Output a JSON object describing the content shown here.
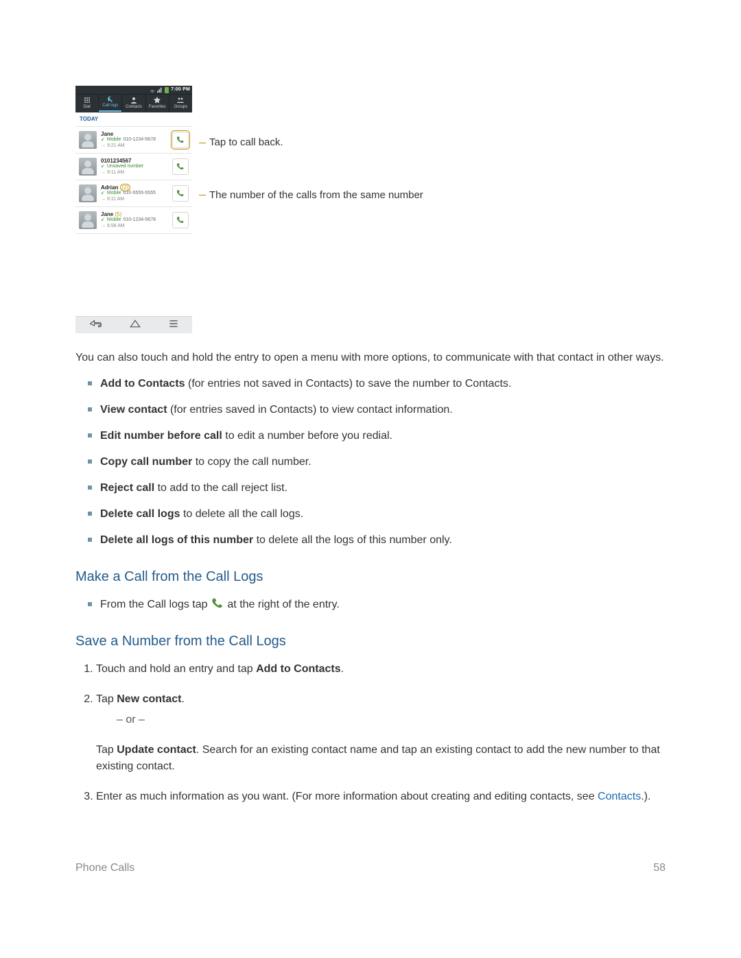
{
  "figure": {
    "status_bar": {
      "time": "7:00 PM"
    },
    "tabs": {
      "dial": "Dial",
      "call_logs": "Call logs",
      "contacts": "Contacts",
      "favorites": "Favorites",
      "groups": "Groups"
    },
    "section_today": "TODAY",
    "rows": [
      {
        "name": "Jane",
        "count": "",
        "type": "Mobile",
        "number": "010-1234-5678",
        "time": "9:21 AM"
      },
      {
        "name": "0101234567",
        "count": "",
        "type": "Unsaved number",
        "number": "",
        "time": "9:11 AM"
      },
      {
        "name": "Adrian",
        "count": "(2)",
        "type": "Mobile",
        "number": "010-5555-5555",
        "time": "9:11 AM"
      },
      {
        "name": "Jane",
        "count": "(5)",
        "type": "Mobile",
        "number": "010-1234-5678",
        "time": "8:58 AM"
      }
    ],
    "callouts": {
      "tap_to_call_back": "Tap to call back.",
      "count_meaning": "The number of the calls from the same number"
    }
  },
  "body": {
    "p1": "You can also touch and hold the entry to open a menu with more options, to communicate with that contact in other ways.",
    "options": {
      "add_to_contacts_label": "Add to Contacts",
      "add_to_contacts_rest": " (for entries not saved in Contacts) to save the number to Contacts.",
      "view_contact_label": "View contact",
      "view_contact_rest": " (for entries saved in Contacts) to view contact information.",
      "edit_number_label": "Edit number before call",
      "edit_number_rest": " to edit a number before you redial.",
      "copy_call_label": "Copy call number",
      "copy_call_rest": " to copy the call number.",
      "reject_call_label": "Reject call",
      "reject_call_rest": " to add to the call reject list.",
      "delete_call_logs_label": "Delete call logs",
      "delete_call_logs_rest": " to delete all the call logs.",
      "delete_all_logs_label": "Delete all logs of this number",
      "delete_all_logs_rest": " to delete all the logs of this number only."
    },
    "h_make_call": "Make a Call from the Call Logs",
    "make_call_pre": "From the Call logs tap ",
    "make_call_post": " at the right of the entry.",
    "h_save_number": "Save a Number from the Call Logs",
    "step1_pre": "Touch and hold an entry and tap ",
    "step1_bold": "Add to Contacts",
    "step1_post": ".",
    "step2_pre": "Tap ",
    "step2_bold": "New contact",
    "step2_post": ".",
    "or": "– or –",
    "step2b_pre": "Tap ",
    "step2b_bold": "Update contact",
    "step2b_post": ". Search for an existing contact name and tap an existing contact to add the new number to that existing contact.",
    "step3_pre": "Enter as much information as you want. (For more information about creating and editing contacts, see ",
    "step3_link": "Contacts",
    "step3_post": ".)."
  },
  "footer": {
    "section": "Phone Calls",
    "page": "58"
  }
}
